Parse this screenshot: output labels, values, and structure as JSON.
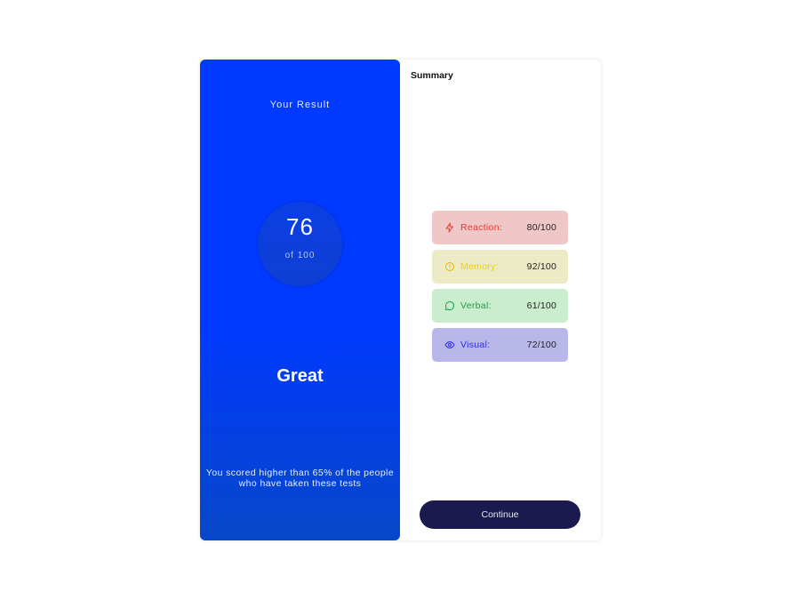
{
  "result": {
    "title": "Your Result",
    "score": "76",
    "score_of": "of 100",
    "rating": "Great",
    "description": "You scored higher than 65% of the people who have taken these tests"
  },
  "summary": {
    "title": "Summary",
    "items": [
      {
        "label": "Reaction:",
        "value": "80/100",
        "icon": "lightning-icon",
        "bg": "#f0c7c7",
        "color": "#e53935"
      },
      {
        "label": "Memory:",
        "value": "92/100",
        "icon": "brain-icon",
        "bg": "#ecebc6",
        "color": "#f3d000"
      },
      {
        "label": "Verbal:",
        "value": "61/100",
        "icon": "chat-icon",
        "bg": "#c9edcd",
        "color": "#1e9e48"
      },
      {
        "label": "Visual:",
        "value": "72/100",
        "icon": "eye-icon",
        "bg": "#b9b7e9",
        "color": "#2c2ce0"
      }
    ],
    "continue_label": "Continue"
  },
  "colors": {
    "accent": "#0039ff",
    "button": "#1b1a4e"
  }
}
